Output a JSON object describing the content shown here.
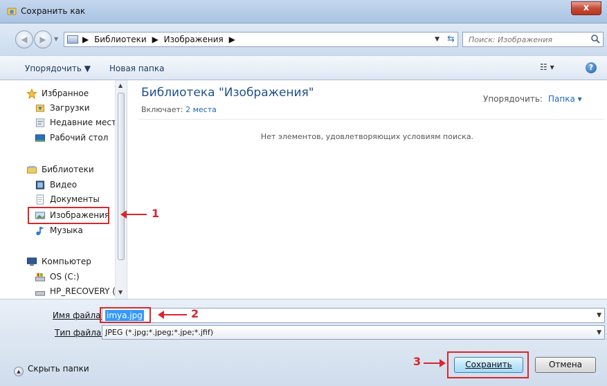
{
  "window": {
    "title": "Сохранить как",
    "close": "x"
  },
  "address": {
    "breadcrumbs": [
      "▶",
      "Библиотеки",
      "▶",
      "Изображения",
      "▶"
    ],
    "search_placeholder": "Поиск: Изображения"
  },
  "toolbar": {
    "organize": "Упорядочить ▼",
    "new_folder": "Новая папка",
    "view": "☷ ▾",
    "help": "?"
  },
  "navigation": {
    "items": [
      {
        "label": "Избранное",
        "icon": "star-icon"
      },
      {
        "label": "Загрузки",
        "icon": "downloads-icon"
      },
      {
        "label": "Недавние места",
        "icon": "recent-places-icon"
      },
      {
        "label": "Рабочий стол",
        "icon": "desktop-icon"
      },
      {
        "label": "Библиотеки",
        "icon": "libraries-icon"
      },
      {
        "label": "Видео",
        "icon": "video-icon"
      },
      {
        "label": "Документы",
        "icon": "documents-icon"
      },
      {
        "label": "Изображения",
        "icon": "pictures-icon"
      },
      {
        "label": "Музыка",
        "icon": "music-icon"
      },
      {
        "label": "Компьютер",
        "icon": "computer-icon"
      },
      {
        "label": "OS (C:)",
        "icon": "drive-icon"
      },
      {
        "label": "HP_RECOVERY (I",
        "icon": "drive-icon"
      }
    ]
  },
  "content": {
    "library_title": "Библиотека \"Изображения\"",
    "includes_label": "Включает:",
    "includes_link": "2 места",
    "arrange_label": "Упорядочить:",
    "arrange_value": "Папка ▾",
    "empty_message": "Нет элементов, удовлетворяющих условиям поиска."
  },
  "fields": {
    "filename_label": "Имя файла:",
    "filename_value": "imya.jpg",
    "filetype_label": "Тип файла:",
    "filetype_value": "JPEG (*.jpg;*.jpeg;*.jpe;*.jfif)"
  },
  "footer": {
    "hide_folders": "Скрыть папки",
    "save": "Сохранить",
    "cancel": "Отмена"
  },
  "annotations": {
    "one": "1",
    "two": "2",
    "three": "3"
  },
  "colors": {
    "annotation": "#d9262b",
    "selection": "#3399ff",
    "link": "#1f67b8"
  }
}
